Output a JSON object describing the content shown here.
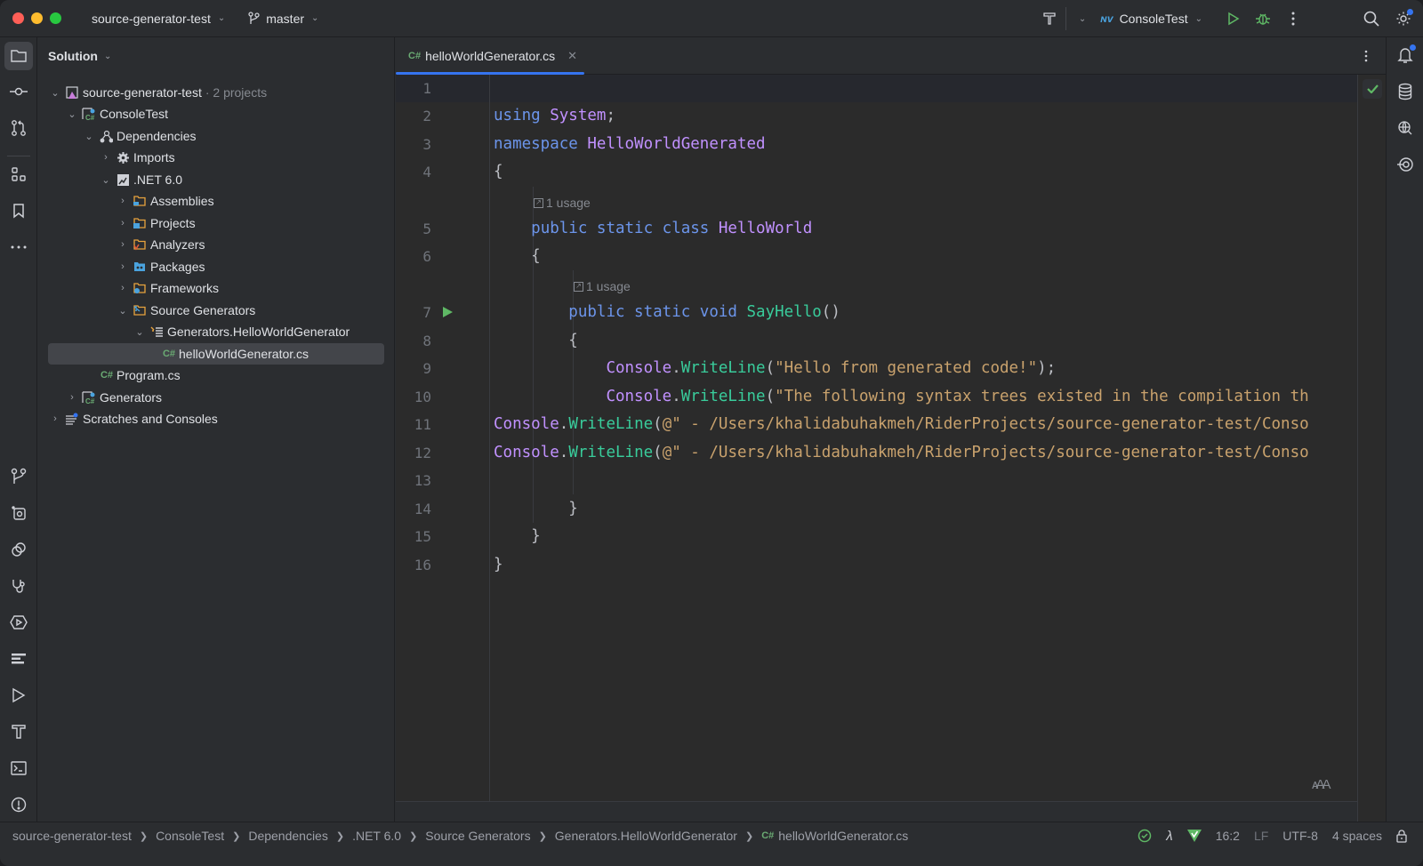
{
  "titlebar": {
    "project_name": "source-generator-test",
    "branch": "master",
    "run_config": "ConsoleTest"
  },
  "left_strip": {
    "top_icons": [
      "project-folder",
      "commit",
      "pull-requests",
      "structure",
      "bookmarks",
      "more"
    ],
    "bottom_icons": [
      "git",
      "services",
      "dynamic-program-analysis",
      "diagnostics",
      "debug-run",
      "problems-list",
      "run",
      "build",
      "terminal",
      "problems"
    ]
  },
  "right_strip": {
    "icons": [
      "notifications",
      "database",
      "endpoints",
      "unit-tests"
    ]
  },
  "project_panel": {
    "header": "Solution",
    "tree": [
      {
        "label": "source-generator-test",
        "suffix": "· 2 projects",
        "depth": 0,
        "expanded": true,
        "icon": "solution"
      },
      {
        "label": "ConsoleTest",
        "depth": 1,
        "expanded": true,
        "icon": "csharp-project"
      },
      {
        "label": "Dependencies",
        "depth": 2,
        "expanded": true,
        "icon": "dependencies"
      },
      {
        "label": "Imports",
        "depth": 3,
        "expanded": false,
        "icon": "gear"
      },
      {
        "label": ".NET 6.0",
        "depth": 3,
        "expanded": true,
        "icon": "dotnet"
      },
      {
        "label": "Assemblies",
        "depth": 4,
        "expanded": false,
        "icon": "folder-assembly"
      },
      {
        "label": "Projects",
        "depth": 4,
        "expanded": false,
        "icon": "folder-projects"
      },
      {
        "label": "Analyzers",
        "depth": 4,
        "expanded": false,
        "icon": "folder-analyzers"
      },
      {
        "label": "Packages",
        "depth": 4,
        "expanded": false,
        "icon": "folder-packages"
      },
      {
        "label": "Frameworks",
        "depth": 4,
        "expanded": false,
        "icon": "folder-frameworks"
      },
      {
        "label": "Source Generators",
        "depth": 4,
        "expanded": true,
        "icon": "folder-generators"
      },
      {
        "label": "Generators.HelloWorldGenerator",
        "depth": 5,
        "expanded": true,
        "icon": "generator"
      },
      {
        "label": "helloWorldGenerator.cs",
        "depth": 6,
        "icon": "csharp-file",
        "selected": true
      },
      {
        "label": "Program.cs",
        "depth": 2,
        "icon": "csharp-file"
      },
      {
        "label": "Generators",
        "depth": 1,
        "expanded": false,
        "icon": "csharp-project"
      },
      {
        "label": "Scratches and Consoles",
        "depth": 0,
        "expanded": false,
        "icon": "scratches"
      }
    ]
  },
  "editor": {
    "tab": {
      "label": "helloWorldGenerator.cs",
      "lang_badge": "C#"
    },
    "inline_hints": {
      "usage_1": "1 usage",
      "usage_2": "1 usage"
    },
    "lines": [
      {
        "n": "1",
        "text": ""
      },
      {
        "n": "2",
        "text": "using System;"
      },
      {
        "n": "3",
        "text": "namespace HelloWorldGenerated"
      },
      {
        "n": "4",
        "text": "{"
      },
      {
        "n": "5",
        "text": "    public static class HelloWorld"
      },
      {
        "n": "6",
        "text": "    {"
      },
      {
        "n": "7",
        "text": "        public static void SayHello()"
      },
      {
        "n": "8",
        "text": "        {"
      },
      {
        "n": "9",
        "text": "            Console.WriteLine(\"Hello from generated code!\");"
      },
      {
        "n": "10",
        "text": "            Console.WriteLine(\"The following syntax trees existed in the compilation th"
      },
      {
        "n": "11",
        "text": "Console.WriteLine(@\" - /Users/khalidabuhakmeh/RiderProjects/source-generator-test/Conso"
      },
      {
        "n": "12",
        "text": "Console.WriteLine(@\" - /Users/khalidabuhakmeh/RiderProjects/source-generator-test/Conso"
      },
      {
        "n": "13",
        "text": ""
      },
      {
        "n": "14",
        "text": "        }"
      },
      {
        "n": "15",
        "text": "    }"
      },
      {
        "n": "16",
        "text": "}"
      }
    ],
    "tokens": {
      "l2": {
        "kw": "using",
        "ty": "System",
        "pl": ";"
      },
      "l3": {
        "kw": "namespace",
        "ty": "HelloWorldGenerated"
      },
      "l5": {
        "kw": "public static class",
        "ty": "HelloWorld"
      },
      "l7": {
        "kw": "public static void",
        "fn": "SayHello",
        "pl": "()"
      },
      "l9": {
        "ty": "Console",
        "dot": ".",
        "fn": "WriteLine",
        "open": "(",
        "st": "\"Hello from generated code!\"",
        "close": ");"
      },
      "l10": {
        "ty": "Console",
        "dot": ".",
        "fn": "WriteLine",
        "open": "(",
        "st": "\"The following syntax trees existed in the compilation th"
      },
      "l11": {
        "ty": "Console",
        "dot": ".",
        "fn": "WriteLine",
        "open": "(",
        "st": "@\" - /Users/khalidabuhakmeh/RiderProjects/source-generator-test/Conso"
      },
      "l12": {
        "ty": "Console",
        "dot": ".",
        "fn": "WriteLine",
        "open": "(",
        "st": "@\" - /Users/khalidabuhakmeh/RiderProjects/source-generator-test/Conso"
      },
      "brace_open": "{",
      "brace_close": "}"
    }
  },
  "statusbar": {
    "breadcrumbs": [
      "source-generator-test",
      "ConsoleTest",
      "Dependencies",
      ".NET 6.0",
      "Source Generators",
      "Generators.HelloWorldGenerator",
      "helloWorldGenerator.cs"
    ],
    "crumb_badge": "C#",
    "cursor_position": "16:2",
    "line_separator": "LF",
    "encoding": "UTF-8",
    "indent": "4 spaces"
  },
  "colors": {
    "accent": "#3574f0",
    "run_green": "#5fb865",
    "keyword": "#6c95eb",
    "type": "#c191ff",
    "method": "#39cc9b",
    "string": "#c9a26d"
  }
}
